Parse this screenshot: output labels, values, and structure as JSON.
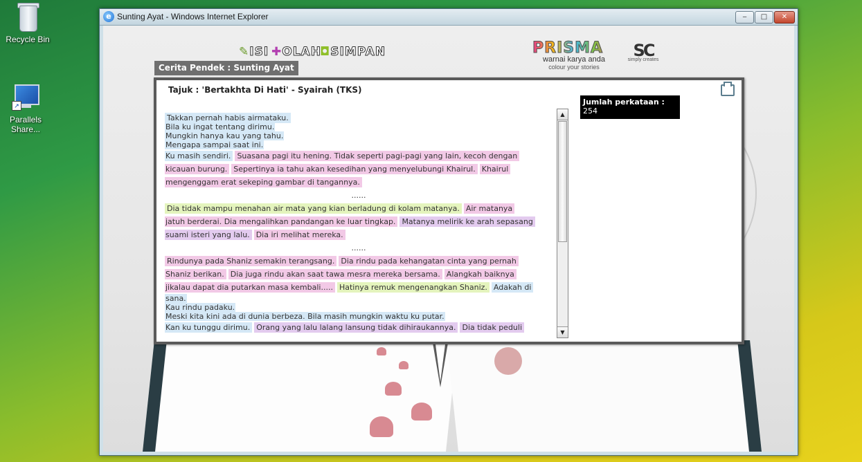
{
  "desktop": {
    "icons": [
      {
        "label": "Recycle Bin",
        "icon": "recycle-bin-icon"
      },
      {
        "label": "Parallels Share...",
        "icon": "parallels-share-icon"
      }
    ]
  },
  "window": {
    "title": "Sunting Ayat - Windows Internet Explorer",
    "controls": {
      "minimize": "‒",
      "maximize": "□",
      "close": "✕"
    }
  },
  "menu": {
    "isi": "ISI",
    "olah": "OLAH",
    "simpan": "SIMPAN"
  },
  "branding": {
    "prisma": "PRISMA",
    "tagline1": "warnai karya anda",
    "tagline2": "colour your stories",
    "simply_creates": "simply creates"
  },
  "section_tab": "Cerita Pendek : Sunting Ayat",
  "story": {
    "heading": "Tajuk : 'Bertakhta Di Hati' - Syairah (TKS)",
    "word_count_label": "Jumlah perkataan :",
    "word_count": "254",
    "lines": {
      "l1": "Takkan pernah habis airmataku.",
      "l2": "Bila ku ingat tentang dirimu.",
      "l3": "Mungkin hanya kau yang tahu.",
      "l4": "Mengapa sampai saat ini.",
      "l5a": "Ku masih sendiri.",
      "l5b": "Suasana pagi itu hening. Tidak seperti pagi-pagi yang lain, kecoh dengan",
      "l6a": "kicauan burung.",
      "l6b": "Sepertinya ia tahu akan kesedihan yang menyelubungi Khairul.",
      "l6c": "Khairul",
      "l7": "mengenggam erat sekeping gambar di tangannya.",
      "sep1": "......",
      "l8a": "Dia tidak mampu menahan air mata yang kian berladung di kolam matanya.",
      "l8b": "Air matanya",
      "l9a": "jatuh berderai. Dia mengalihkan pandangan ke luar tingkap.",
      "l9b": "Matanya melirik ke arah sepasang",
      "l10a": "suami isteri yang lalu.",
      "l10b": "Dia iri melihat mereka.",
      "sep2": "......",
      "l11a": "Rindunya pada Shaniz semakin terangsang.",
      "l11b": "Dia rindu pada kehangatan cinta yang pernah",
      "l12a": "Shaniz berikan.",
      "l12b": "Dia juga rindu akan saat tawa mesra mereka bersama.",
      "l12c": "Alangkah baiknya",
      "l13a": "jikalau dapat dia putarkan masa kembali.....",
      "l13b": "Hatinya remuk mengenangkan Shaniz.",
      "l13c": "Adakah di",
      "l14": "sana.",
      "l15": "Kau rindu padaku.",
      "l16": "Meski kita kini ada di dunia berbeza. Bila masih mungkin waktu ku putar.",
      "l17a": "Kan ku tunggu dirimu.",
      "l17b": "Orang yang lalu lalang lansung tidak dihiraukannya.",
      "l17c": "Dia tidak peduli"
    }
  },
  "colors": {
    "highlight_blue": "#d5e8f6",
    "highlight_pink": "#f2c9e6",
    "highlight_green": "#e4f4bd",
    "highlight_purple": "#e3cbef"
  }
}
